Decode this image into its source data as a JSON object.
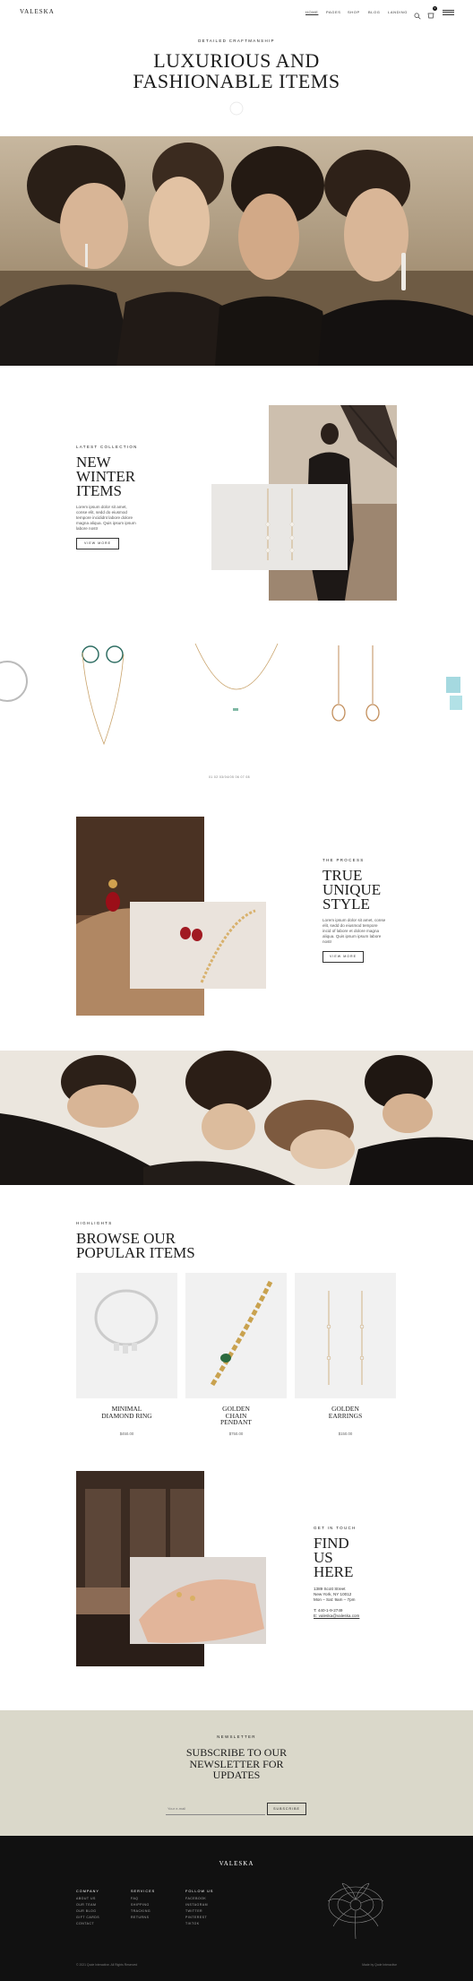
{
  "header": {
    "logo": "VALESKA",
    "nav": [
      "HOME",
      "PAGES",
      "SHOP",
      "BLOG",
      "LANDING"
    ],
    "cart_count": "0"
  },
  "hero": {
    "eyebrow": "DETAILED CRAFTMANSHIP",
    "title": "LUXURIOUS AND FASHIONABLE ITEMS"
  },
  "collection": {
    "eyebrow": "LATEST COLLECTION",
    "title": "NEW WINTER ITEMS",
    "text": "Lorem ipsum dolor sit amet, conse elit, sedd do eiusmod tempore incididnt labore dolore magna aliqua. Quis ipsum ipsum labore nostr",
    "button": "VIEW MORE"
  },
  "carousel": {
    "pager": "01  02  03/04/05  06  07  08"
  },
  "process": {
    "eyebrow": "THE PROCESS",
    "title": "TRUE UNIQUE STYLE",
    "text": "Lorem ipsum dolor sit amet, conse elit, sedd do eiusmod tempore incid of labore et dolore magna aliqua. Quis ipsum ipsum labore nostr",
    "button": "VIEW MORE"
  },
  "popular": {
    "eyebrow": "HIGHLIGHTS",
    "title": "BROWSE OUR POPULAR ITEMS",
    "items": [
      {
        "name": "MINIMAL DIAMOND RING",
        "price": "$450.00"
      },
      {
        "name": "GOLDEN CHAIN PENDANT",
        "price": "$750.00"
      },
      {
        "name": "GOLDEN EARRINGS",
        "price": "$150.00"
      }
    ]
  },
  "contact": {
    "eyebrow": "GET IN TOUCH",
    "title": "FIND US HERE",
    "address1": "1389 Scott Street",
    "address2": "New York, NY 10012",
    "hours": "Mon – Sat: 9am – 7pm",
    "phone": "T: 440-1-9-2749",
    "email": "E: valeska@valeska.com"
  },
  "newsletter": {
    "eyebrow": "NEWSLETTER",
    "title": "SUBSCRIBE TO OUR NEWSLETTER FOR UPDATES",
    "placeholder": "Your e-mail",
    "button": "SUBSCRIBE"
  },
  "footer": {
    "logo": "VALESKA",
    "columns": [
      {
        "title": "COMPANY",
        "links": [
          "ABOUT US",
          "OUR TEAM",
          "OUR BLOG",
          "GIFT CARDS",
          "CONTACT"
        ]
      },
      {
        "title": "SERVICES",
        "links": [
          "FAQ",
          "SHIPPING",
          "TRACKING",
          "RETURNS"
        ]
      },
      {
        "title": "FOLLOW US",
        "links": [
          "FACEBOOK",
          "INSTAGRAM",
          "TWITTER",
          "PINTEREST",
          "TIKTOK"
        ]
      }
    ],
    "copyright": "© 2021 Qode Interactive. All Rights Reserved",
    "credit": "Made by Qode Interactive"
  }
}
